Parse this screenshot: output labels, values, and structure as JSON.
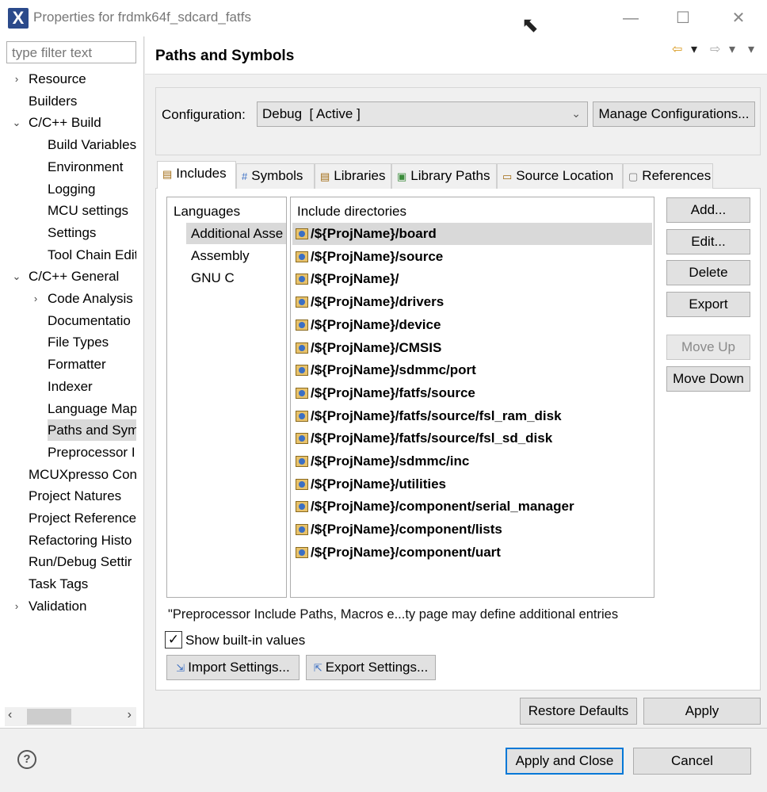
{
  "window": {
    "title": "Properties for frdmk64f_sdcard_fatfs",
    "app_icon": "X",
    "minimize": "—",
    "maximize": "☐",
    "close": "✕"
  },
  "filter": {
    "placeholder": "type filter text"
  },
  "tree": [
    {
      "label": "Resource",
      "twisty": "›"
    },
    {
      "label": "Builders",
      "twisty": ""
    },
    {
      "label": "C/C++ Build",
      "twisty": "⌄"
    },
    {
      "label": "Build Variables",
      "twisty": ""
    },
    {
      "label": "Environment",
      "twisty": ""
    },
    {
      "label": "Logging",
      "twisty": ""
    },
    {
      "label": "MCU settings",
      "twisty": ""
    },
    {
      "label": "Settings",
      "twisty": ""
    },
    {
      "label": "Tool Chain Edit",
      "twisty": ""
    },
    {
      "label": "C/C++ General",
      "twisty": "⌄"
    },
    {
      "label": "Code Analysis",
      "twisty": "›"
    },
    {
      "label": "Documentatio",
      "twisty": ""
    },
    {
      "label": "File Types",
      "twisty": ""
    },
    {
      "label": "Formatter",
      "twisty": ""
    },
    {
      "label": "Indexer",
      "twisty": ""
    },
    {
      "label": "Language Map",
      "twisty": ""
    },
    {
      "label": "Paths and Sym",
      "twisty": ""
    },
    {
      "label": "Preprocessor I",
      "twisty": ""
    },
    {
      "label": "MCUXpresso Con",
      "twisty": ""
    },
    {
      "label": "Project Natures",
      "twisty": ""
    },
    {
      "label": "Project References",
      "twisty": ""
    },
    {
      "label": "Refactoring Histo",
      "twisty": ""
    },
    {
      "label": "Run/Debug Settir",
      "twisty": ""
    },
    {
      "label": "Task Tags",
      "twisty": ""
    },
    {
      "label": "Validation",
      "twisty": "›"
    }
  ],
  "header": {
    "title": "Paths and Symbols"
  },
  "config": {
    "label": "Configuration:",
    "value": "Debug  [ Active ]",
    "manage_label": "Manage Configurations..."
  },
  "tabs": [
    {
      "label": "Includes",
      "icon": "folder-include-icon",
      "glyph": "📂"
    },
    {
      "label": "Symbols",
      "icon": "hash-icon",
      "glyph": "#"
    },
    {
      "label": "Libraries",
      "icon": "library-icon",
      "glyph": "▤"
    },
    {
      "label": "Library Paths",
      "icon": "library-path-icon",
      "glyph": "▣"
    },
    {
      "label": "Source Location",
      "icon": "source-folder-icon",
      "glyph": "▭"
    },
    {
      "label": "References",
      "icon": "reference-icon",
      "glyph": "▢"
    }
  ],
  "languages": {
    "header": "Languages",
    "items": [
      "Additional Asse",
      "Assembly",
      "GNU C"
    ]
  },
  "includes": {
    "header": "Include directories",
    "items": [
      "/${ProjName}/board",
      "/${ProjName}/source",
      "/${ProjName}/",
      "/${ProjName}/drivers",
      "/${ProjName}/device",
      "/${ProjName}/CMSIS",
      "/${ProjName}/sdmmc/port",
      "/${ProjName}/fatfs/source",
      "/${ProjName}/fatfs/source/fsl_ram_disk",
      "/${ProjName}/fatfs/source/fsl_sd_disk",
      "/${ProjName}/sdmmc/inc",
      "/${ProjName}/utilities",
      "/${ProjName}/component/serial_manager",
      "/${ProjName}/component/lists",
      "/${ProjName}/component/uart"
    ]
  },
  "side_buttons": {
    "add": "Add...",
    "edit": "Edit...",
    "delete": "Delete",
    "export": "Export",
    "move_up": "Move Up",
    "move_down": "Move Down"
  },
  "note": "\"Preprocessor Include Paths, Macros e...ty page may define additional entries",
  "show_builtin": {
    "label": "Show built-in values",
    "checked": "✓"
  },
  "import_label": "Import Settings...",
  "export_label": "Export Settings...",
  "restore_label": "Restore Defaults",
  "apply_label": "Apply",
  "apply_close_label": "Apply and Close",
  "cancel_label": "Cancel",
  "help_glyph": "?"
}
